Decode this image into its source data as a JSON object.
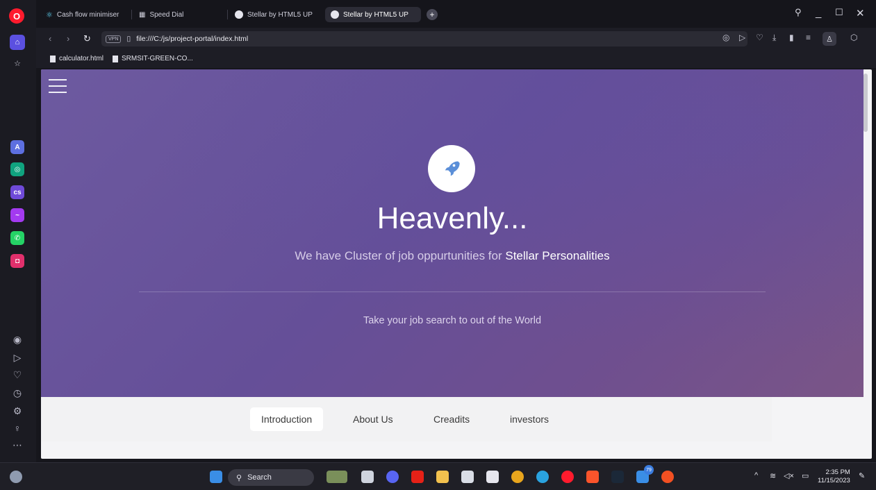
{
  "browser": {
    "tabs": [
      {
        "label": "Cash flow minimiser",
        "active": false
      },
      {
        "label": "Speed Dial",
        "active": false
      },
      {
        "label": "Stellar by HTML5 UP",
        "active": false
      },
      {
        "label": "Stellar by HTML5 UP",
        "active": true
      }
    ],
    "new_tab_label": "+",
    "url": "file:///C:/js/project-portal/index.html",
    "vpn_label": "VPN",
    "bookmarks": [
      {
        "label": "calculator.html"
      },
      {
        "label": "SRMSIT-GREEN-CO..."
      }
    ]
  },
  "hero": {
    "title": "Heavenly...",
    "subtitle_prefix": "We have Cluster of job oppurtunities for ",
    "subtitle_highlight": "Stellar Personalities",
    "tagline": "Take your job search to out of the World"
  },
  "nav": {
    "items": [
      {
        "label": "Introduction",
        "active": true
      },
      {
        "label": "About Us",
        "active": false
      },
      {
        "label": "Creadits",
        "active": false
      },
      {
        "label": "investors",
        "active": false
      }
    ]
  },
  "taskbar": {
    "search_label": "Search",
    "time": "2:35 PM",
    "date": "11/15/2023",
    "notification_count": "79"
  },
  "colors": {
    "hero_start": "#6d5aa0",
    "hero_end": "#7a5587",
    "opera_red": "#ff1b2d",
    "opera_accent": "#5b50e0"
  }
}
